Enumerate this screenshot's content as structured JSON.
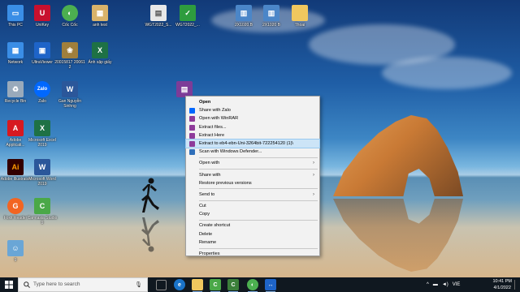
{
  "desktop": {
    "icons": [
      {
        "label": "This PC",
        "icon": "computer-icon",
        "color": "#3a8ee6"
      },
      {
        "label": "UniKey",
        "icon": "unikey-icon",
        "color": "#c8102e"
      },
      {
        "label": "Cốc Cốc",
        "icon": "coccoc-icon",
        "color": "#4caf50"
      },
      {
        "label": "anh test",
        "icon": "folder-image-icon",
        "color": "#d9b36a"
      },
      {
        "label": "WGT2022_S...",
        "icon": "file-image-icon",
        "color": "#e8e8e8"
      },
      {
        "label": "WGT2022_...",
        "icon": "file-winrar-icon",
        "color": "#2e9c3e"
      },
      {
        "label": "2X1020.B",
        "icon": "file-icon",
        "color": "#4b86c8"
      },
      {
        "label": "2X1020 B",
        "icon": "file-icon",
        "color": "#4b86c8"
      },
      {
        "label": "Thoai",
        "icon": "folder-icon",
        "color": "#f0c75e"
      },
      {
        "label": "Network",
        "icon": "network-icon",
        "color": "#3a8ee6"
      },
      {
        "label": "UltraViewer",
        "icon": "ultraviewer-icon",
        "color": "#1e64c8"
      },
      {
        "label": "20015817 20061 2",
        "icon": "file-image-icon",
        "color": "#a07f3c"
      },
      {
        "label": "Ảnh sập giấy",
        "icon": "excel-file-icon",
        "color": "#1e7145"
      },
      {
        "label": "Recycle Bin",
        "icon": "recycle-bin-icon",
        "color": "#9ab"
      },
      {
        "label": "Zalo",
        "icon": "zalo-icon",
        "color": "#0068ff"
      },
      {
        "label": "Gan Nguyễn Sinhng",
        "icon": "word-file-icon",
        "color": "#2b579a"
      },
      {
        "label": "eb4-ebn-Uni-3264bit-722254120",
        "icon": "winrar-archive-icon",
        "color": "#7d3c98"
      },
      {
        "label": "Adobe Applicati...",
        "icon": "adobe-icon",
        "color": "#d71920"
      },
      {
        "label": "Microsoft Excel 2019",
        "icon": "excel-icon",
        "color": "#1e7145"
      },
      {
        "label": "Adobe Illustrator",
        "icon": "illustrator-icon",
        "color": "#330000"
      },
      {
        "label": "Microsoft Word 2019",
        "icon": "word-icon",
        "color": "#2b579a"
      },
      {
        "label": "Foxit Reader",
        "icon": "foxit-icon",
        "color": "#f26522"
      },
      {
        "label": "Camtasia Studio 9",
        "icon": "camtasia-icon",
        "color": "#4aa848"
      },
      {
        "label": "9",
        "icon": "user-icon",
        "color": "#6aa6d6"
      }
    ]
  },
  "context_menu": {
    "items": [
      {
        "type": "item",
        "label": "Open",
        "bold": true
      },
      {
        "type": "item",
        "label": "Share with Zalo",
        "icon": "zalo-icon",
        "icon_color": "#0068ff"
      },
      {
        "type": "item",
        "label": "Open with WinRAR",
        "icon": "winrar-icon",
        "icon_color": "#8e3b9a"
      },
      {
        "type": "item",
        "label": "Extract files...",
        "icon": "winrar-icon",
        "icon_color": "#8e3b9a"
      },
      {
        "type": "item",
        "label": "Extract Here",
        "icon": "winrar-icon",
        "icon_color": "#8e3b9a"
      },
      {
        "type": "item",
        "label": "Extract to eb4-ebn-Uni-3264bit-722254120 (1)\\",
        "icon": "winrar-icon",
        "icon_color": "#8e3b9a",
        "highlighted": true
      },
      {
        "type": "item",
        "label": "Scan with Windows Defender...",
        "icon": "defender-icon",
        "icon_color": "#2f6fba"
      },
      {
        "type": "separator"
      },
      {
        "type": "item",
        "label": "Open with",
        "submenu": true
      },
      {
        "type": "separator"
      },
      {
        "type": "item",
        "label": "Share with",
        "submenu": true
      },
      {
        "type": "item",
        "label": "Restore previous versions"
      },
      {
        "type": "separator"
      },
      {
        "type": "item",
        "label": "Send to",
        "submenu": true
      },
      {
        "type": "separator"
      },
      {
        "type": "item",
        "label": "Cut"
      },
      {
        "type": "item",
        "label": "Copy"
      },
      {
        "type": "separator"
      },
      {
        "type": "item",
        "label": "Create shortcut"
      },
      {
        "type": "item",
        "label": "Delete"
      },
      {
        "type": "item",
        "label": "Rename"
      },
      {
        "type": "separator"
      },
      {
        "type": "item",
        "label": "Properties"
      }
    ],
    "submenu_arrow": "›"
  },
  "taskbar": {
    "search_placeholder": "Type here to search",
    "apps": [
      {
        "name": "task-view-icon",
        "color": "#101820",
        "glyph": "⧉"
      },
      {
        "name": "edge-icon",
        "color": "#1a73c8",
        "glyph": "e"
      },
      {
        "name": "file-explorer-icon",
        "color": "#f0c75e",
        "glyph": "▬"
      },
      {
        "name": "camtasia-icon",
        "color": "#4aa848",
        "glyph": "C"
      },
      {
        "name": "camtasia-recorder-icon",
        "color": "#3b7f3a",
        "glyph": "C"
      },
      {
        "name": "coccoc-icon",
        "color": "#4caf50",
        "glyph": "◐"
      },
      {
        "name": "teamviewer-icon",
        "color": "#1e64c8",
        "glyph": "↔"
      }
    ],
    "tray": {
      "language": "VIE",
      "time": "10:41 PM",
      "date": "4/1/2022"
    }
  }
}
